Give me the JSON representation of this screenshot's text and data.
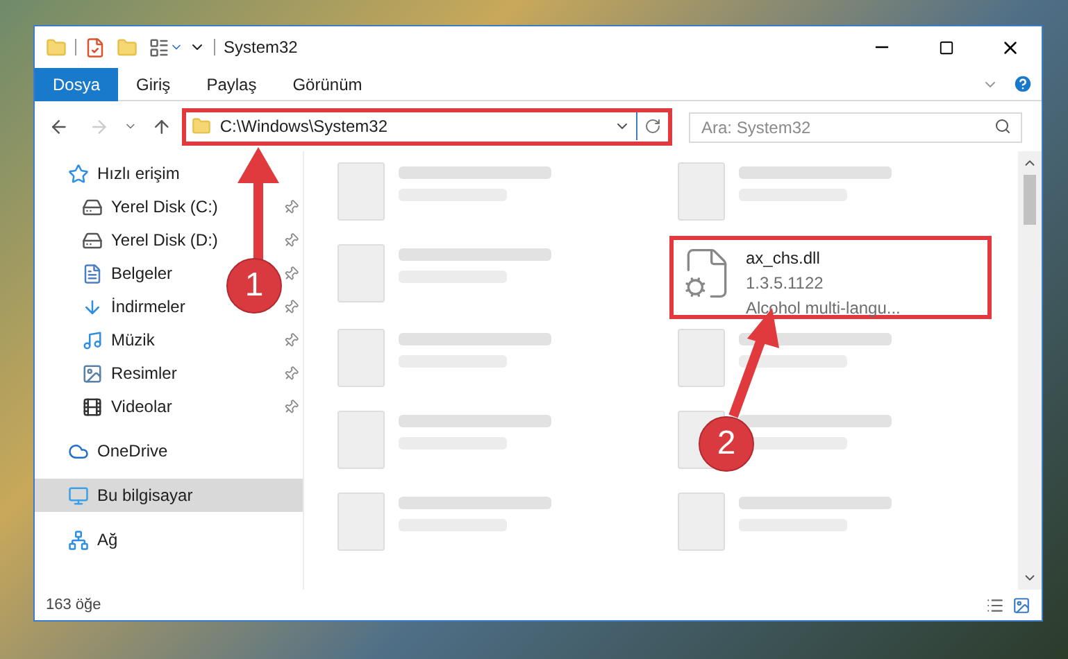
{
  "window": {
    "title": "System32"
  },
  "ribbon_tabs": [
    {
      "label": "Dosya",
      "selected": true
    },
    {
      "label": "Giriş",
      "selected": false
    },
    {
      "label": "Paylaş",
      "selected": false
    },
    {
      "label": "Görünüm",
      "selected": false
    }
  ],
  "address_bar": {
    "value": "C:\\Windows\\System32"
  },
  "search": {
    "placeholder": "Ara: System32"
  },
  "sidebar": [
    {
      "label": "Hızlı erişim",
      "kind": "star",
      "selected": false,
      "children": [
        {
          "label": "Yerel Disk (C:)",
          "kind": "drive",
          "pinned": true,
          "selected": false
        },
        {
          "label": "Yerel Disk (D:)",
          "kind": "drive",
          "pinned": true,
          "selected": false
        },
        {
          "label": "Belgeler",
          "kind": "document",
          "pinned": true,
          "selected": false
        },
        {
          "label": "İndirmeler",
          "kind": "download",
          "pinned": true,
          "selected": false
        },
        {
          "label": "Müzik",
          "kind": "music",
          "pinned": true,
          "selected": false
        },
        {
          "label": "Resimler",
          "kind": "picture",
          "pinned": true,
          "selected": false
        },
        {
          "label": "Videolar",
          "kind": "video",
          "pinned": true,
          "selected": false
        }
      ]
    },
    {
      "label": "OneDrive",
      "kind": "cloud",
      "selected": false
    },
    {
      "label": "Bu bilgisayar",
      "kind": "computer",
      "selected": true
    },
    {
      "label": "Ağ",
      "kind": "network",
      "selected": false
    }
  ],
  "files": [
    {
      "kind": "blurred"
    },
    {
      "kind": "blurred"
    },
    {
      "kind": "blurred"
    },
    {
      "kind": "file",
      "name": "ax_chs.dll",
      "lines": [
        "1.3.5.1122",
        "Alcohol multi-langu..."
      ]
    },
    {
      "kind": "blurred"
    },
    {
      "kind": "blurred"
    },
    {
      "kind": "blurred"
    },
    {
      "kind": "blurred"
    },
    {
      "kind": "blurred"
    },
    {
      "kind": "blurred"
    }
  ],
  "status_bar": {
    "count": "163 öğe"
  },
  "annotations": [
    {
      "number": "1"
    },
    {
      "number": "2"
    }
  ]
}
